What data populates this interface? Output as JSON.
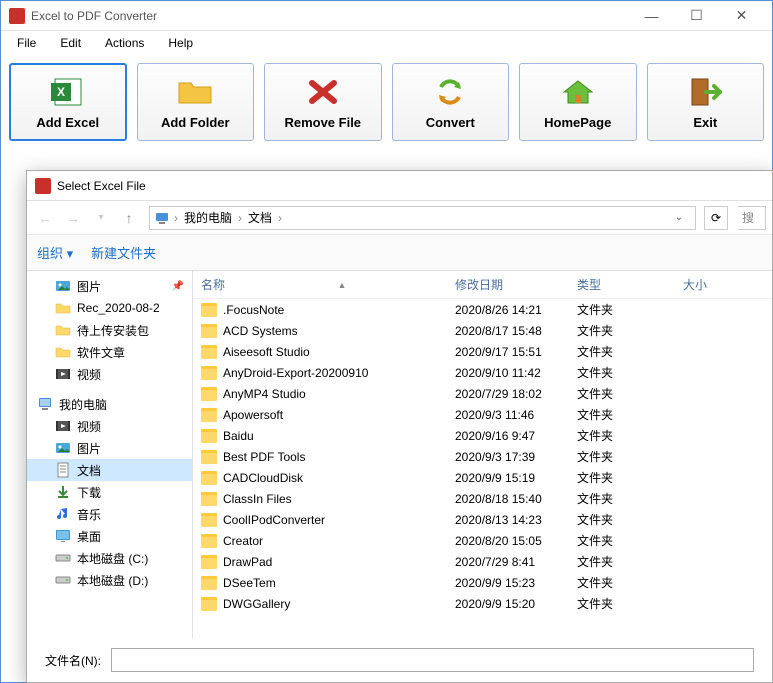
{
  "app": {
    "title": "Excel to PDF Converter"
  },
  "menu": {
    "file": "File",
    "edit": "Edit",
    "actions": "Actions",
    "help": "Help"
  },
  "toolbar": {
    "add_excel": "Add Excel",
    "add_folder": "Add Folder",
    "remove_file": "Remove File",
    "convert": "Convert",
    "homepage": "HomePage",
    "exit": "Exit"
  },
  "dialog": {
    "title": "Select Excel File",
    "crumbs": {
      "pc": "我的电脑",
      "docs": "文档"
    },
    "search_stub": "搜",
    "cmd": {
      "organize": "组织",
      "new_folder": "新建文件夹"
    },
    "cols": {
      "name": "名称",
      "date": "修改日期",
      "type": "类型",
      "size": "大小"
    },
    "filename_label": "文件名(N):"
  },
  "sidebar": [
    {
      "icon": "pictures",
      "label": "图片",
      "indent": 1,
      "pin": true
    },
    {
      "icon": "folder",
      "label": "Rec_2020-08-2",
      "indent": 1
    },
    {
      "icon": "folder",
      "label": "待上传安装包",
      "indent": 1
    },
    {
      "icon": "folder",
      "label": "软件文章",
      "indent": 1
    },
    {
      "icon": "videos",
      "label": "视频",
      "indent": 1
    },
    {
      "icon": "spacer"
    },
    {
      "icon": "pc",
      "label": "我的电脑",
      "indent": 0
    },
    {
      "icon": "videos",
      "label": "视频",
      "indent": 1
    },
    {
      "icon": "pictures",
      "label": "图片",
      "indent": 1
    },
    {
      "icon": "documents",
      "label": "文档",
      "indent": 1,
      "selected": true
    },
    {
      "icon": "downloads",
      "label": "下载",
      "indent": 1
    },
    {
      "icon": "music",
      "label": "音乐",
      "indent": 1
    },
    {
      "icon": "desktop",
      "label": "桌面",
      "indent": 1
    },
    {
      "icon": "drive",
      "label": "本地磁盘 (C:)",
      "indent": 1
    },
    {
      "icon": "drive",
      "label": "本地磁盘 (D:)",
      "indent": 1
    }
  ],
  "files": [
    {
      "name": ".FocusNote",
      "date": "2020/8/26 14:21",
      "type": "文件夹"
    },
    {
      "name": "ACD Systems",
      "date": "2020/8/17 15:48",
      "type": "文件夹"
    },
    {
      "name": "Aiseesoft Studio",
      "date": "2020/9/17 15:51",
      "type": "文件夹"
    },
    {
      "name": "AnyDroid-Export-20200910",
      "date": "2020/9/10 11:42",
      "type": "文件夹"
    },
    {
      "name": "AnyMP4 Studio",
      "date": "2020/7/29 18:02",
      "type": "文件夹"
    },
    {
      "name": "Apowersoft",
      "date": "2020/9/3 11:46",
      "type": "文件夹"
    },
    {
      "name": "Baidu",
      "date": "2020/9/16 9:47",
      "type": "文件夹"
    },
    {
      "name": "Best PDF Tools",
      "date": "2020/9/3 17:39",
      "type": "文件夹"
    },
    {
      "name": "CADCloudDisk",
      "date": "2020/9/9 15:19",
      "type": "文件夹"
    },
    {
      "name": "ClassIn Files",
      "date": "2020/8/18 15:40",
      "type": "文件夹"
    },
    {
      "name": "CoolIPodConverter",
      "date": "2020/8/13 14:23",
      "type": "文件夹"
    },
    {
      "name": "Creator",
      "date": "2020/8/20 15:05",
      "type": "文件夹"
    },
    {
      "name": "DrawPad",
      "date": "2020/7/29 8:41",
      "type": "文件夹"
    },
    {
      "name": "DSeeTem",
      "date": "2020/9/9 15:23",
      "type": "文件夹"
    },
    {
      "name": "DWGGallery",
      "date": "2020/9/9 15:20",
      "type": "文件夹"
    }
  ]
}
